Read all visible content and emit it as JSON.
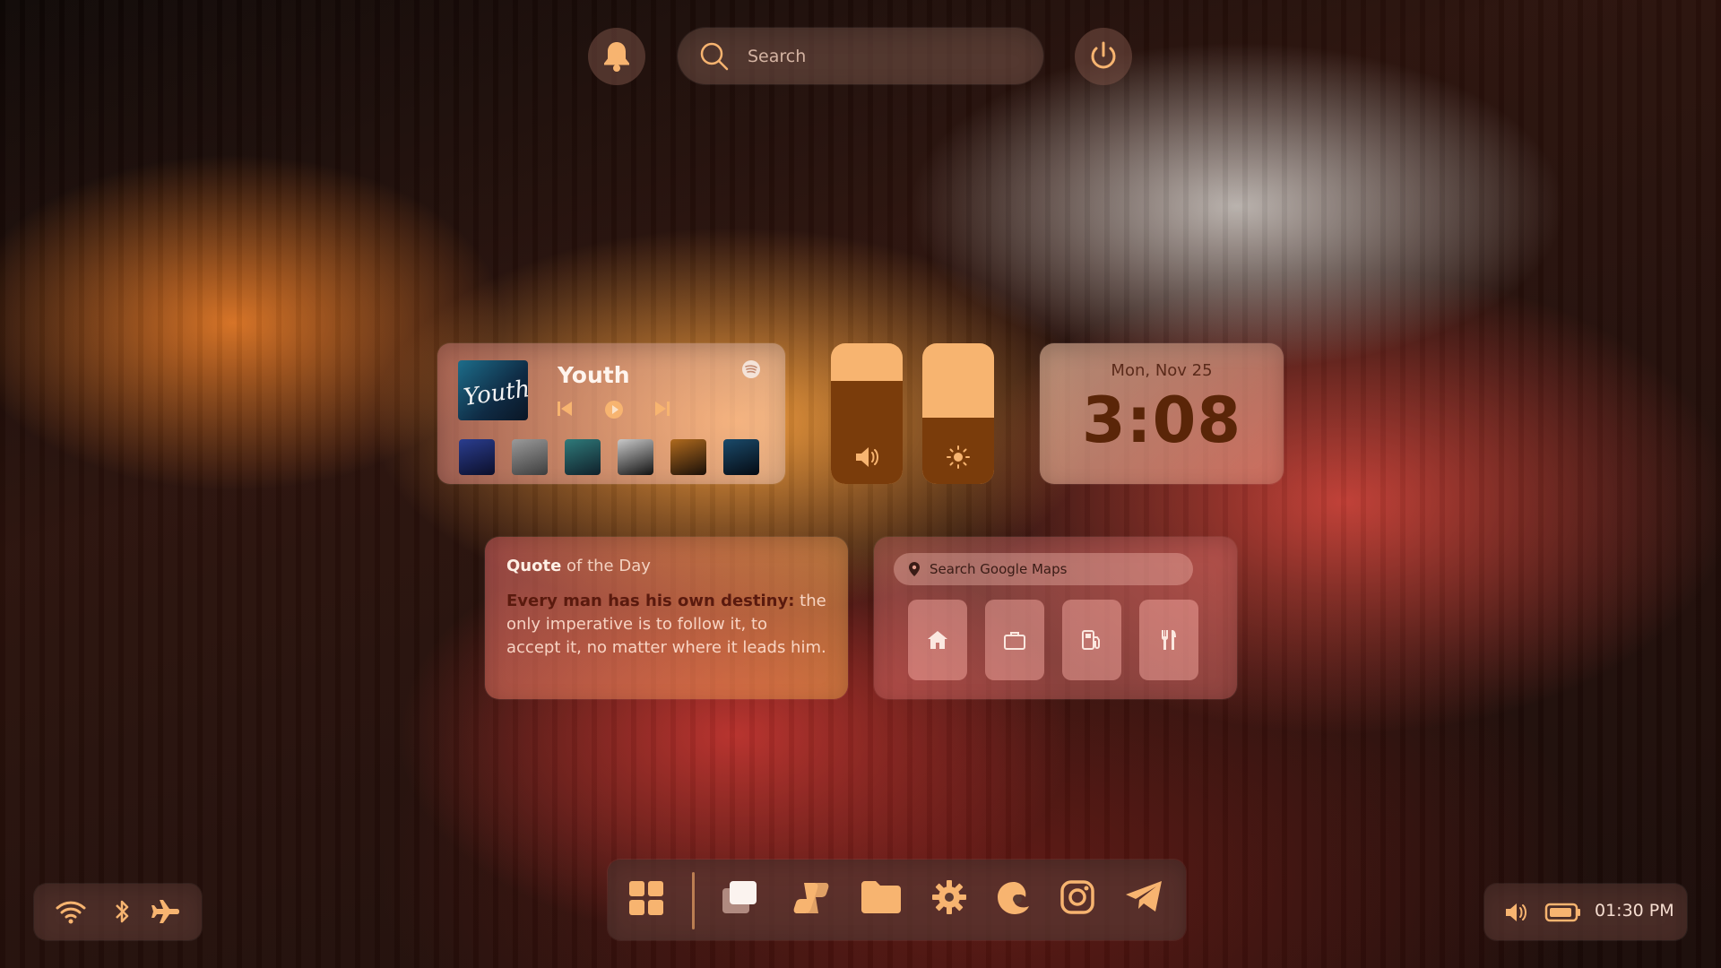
{
  "header": {
    "search_placeholder": "Search",
    "icons": [
      "bell-icon",
      "search-icon",
      "power-icon"
    ]
  },
  "music": {
    "song_title": "Youth",
    "album_art_text": "Youth",
    "source_icon": "spotify-icon",
    "controls": [
      "previous-icon",
      "play-icon",
      "next-icon"
    ],
    "playlist_thumbs": [
      {
        "color_a": "#2a3d8f",
        "color_b": "#0c0f2a"
      },
      {
        "color_a": "#9a9a9a",
        "color_b": "#3d3d3d"
      },
      {
        "color_a": "#2f7a7a",
        "color_b": "#10202a"
      },
      {
        "color_a": "#c9c9c9",
        "color_b": "#111111"
      },
      {
        "color_a": "#b06a1e",
        "color_b": "#1a0f08"
      },
      {
        "color_a": "#1a4a6a",
        "color_b": "#050a12"
      }
    ]
  },
  "sliders": {
    "volume_level": 0.73,
    "brightness_level": 0.47,
    "icons": [
      "volume-icon",
      "brightness-icon"
    ]
  },
  "clock": {
    "date": "Mon, Nov 25",
    "time": "3:08"
  },
  "quote": {
    "heading_bold": "Quote",
    "heading_rest": " of the Day",
    "bold_text": "Every man has his own destiny:",
    "rest_text": " the only imperative is to follow it, to accept it, no matter where it leads him."
  },
  "maps": {
    "search_placeholder": "Search Google Maps",
    "shortcuts": [
      "home-icon",
      "briefcase-icon",
      "gas-station-icon",
      "restaurant-icon"
    ]
  },
  "dock": {
    "apps": [
      "windows-start-icon",
      "task-view-icon",
      "copilot-icon",
      "folder-icon",
      "settings-icon",
      "edge-icon",
      "instagram-icon",
      "telegram-icon"
    ]
  },
  "tray_left": {
    "icons": [
      "wifi-icon",
      "bluetooth-icon",
      "airplane-mode-icon"
    ]
  },
  "tray_right": {
    "icons": [
      "volume-icon",
      "battery-icon"
    ],
    "time": "01:30 PM"
  },
  "colors": {
    "accent": "#f7b470",
    "dark_accent": "#7a3c0b"
  }
}
